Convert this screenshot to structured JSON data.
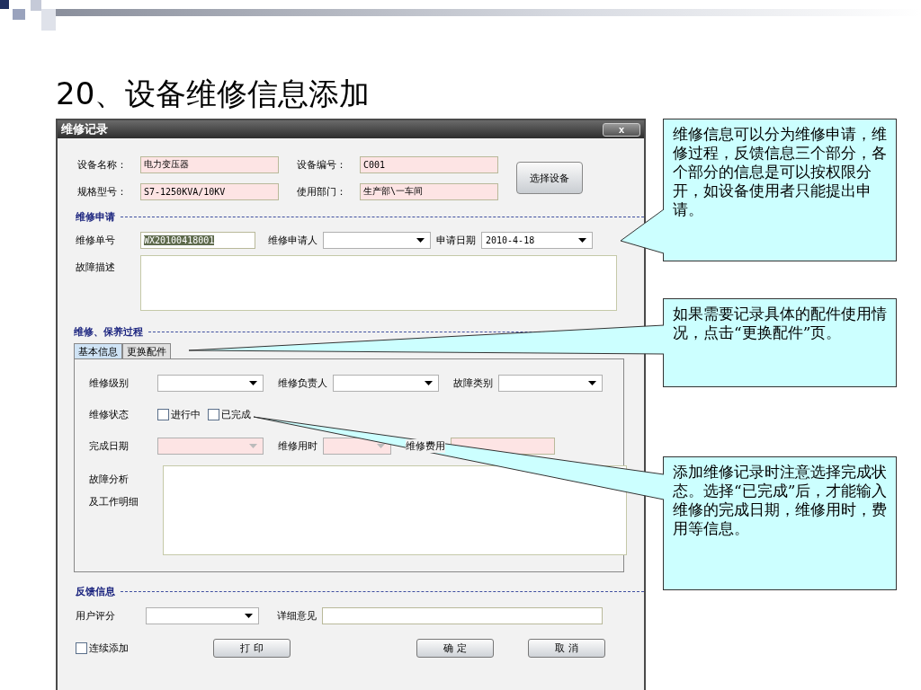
{
  "slide": {
    "title": "20、设备维修信息添加"
  },
  "dialog": {
    "title": "维修记录",
    "close": "x",
    "equipment": [
      {
        "label": "设备名称：",
        "value": "电力变压器",
        "locked": true
      },
      {
        "label": "设备编号：",
        "value": "C001",
        "locked": true
      },
      {
        "label": "规格型号：",
        "value": "S7-1250KVA/10KV",
        "locked": true
      },
      {
        "label": "使用部门：",
        "value": "生产部\\一车间",
        "locked": true
      }
    ],
    "select_button": "选择设备",
    "request": {
      "heading": "维修申请",
      "fields": [
        {
          "label": "维修单号",
          "kind": "text",
          "value": "WX20100418001",
          "highlighted": true,
          "locked": false
        },
        {
          "label": "维修申请人",
          "kind": "dropdown",
          "locked": false
        },
        {
          "label": "申请日期",
          "kind": "dropdown",
          "value": "2010-4-18",
          "locked": false
        }
      ],
      "description": {
        "label": "故障描述"
      }
    },
    "process": {
      "heading": "维修、保养过程",
      "tabs": [
        {
          "label": "基本信息",
          "selected": true
        },
        {
          "label": "更换配件",
          "selected": false
        }
      ],
      "row1": [
        {
          "label": "维修级别",
          "kind": "dropdown",
          "locked": false
        },
        {
          "label": "维修负责人",
          "kind": "dropdown",
          "locked": false
        },
        {
          "label": "故障类别",
          "kind": "dropdown",
          "locked": false
        }
      ],
      "status": {
        "label": "维修状态",
        "options": [
          {
            "label": "进行中",
            "checked": false
          },
          {
            "label": "已完成",
            "checked": false
          }
        ]
      },
      "row3": [
        {
          "label": "完成日期",
          "kind": "dropdown",
          "locked": true
        },
        {
          "label": "维修用时",
          "kind": "dropdown",
          "locked": true
        },
        {
          "label": "维修费用",
          "kind": "text",
          "locked": true
        }
      ],
      "analysis": {
        "label_lines": [
          "故障分析",
          "及工作明细"
        ]
      }
    },
    "feedback": {
      "heading": "反馈信息",
      "rating": {
        "label": "用户评分",
        "kind": "dropdown"
      },
      "opinion": {
        "label": "详细意见",
        "kind": "text"
      }
    },
    "continuous": {
      "label": "连续添加",
      "checked": false
    },
    "buttons": [
      "打 印",
      "确 定",
      "取 消"
    ]
  },
  "callouts": [
    "维修信息可以分为维修申请，维修过程，反馈信息三个部分，各个部分的信息是可以按权限分开，如设备使用者只能提出申请。",
    "如果需要记录具体的配件使用情况，点击“更换配件”页。",
    "添加维修记录时注意选择完成状态。选择“已完成”后，才能输入维修的完成日期，维修用时，费用等信息。"
  ]
}
